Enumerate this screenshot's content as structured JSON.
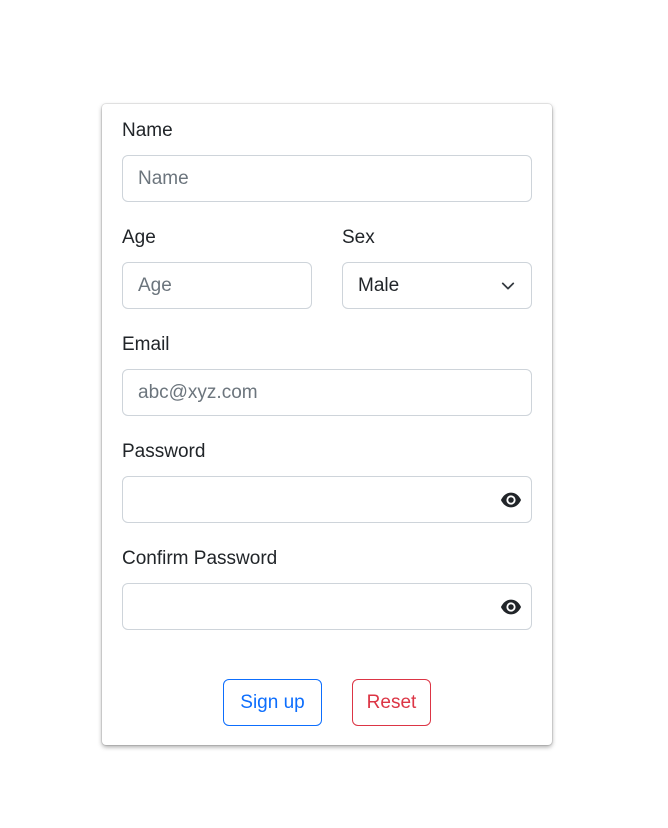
{
  "form": {
    "name": {
      "label": "Name",
      "placeholder": "Name"
    },
    "age": {
      "label": "Age",
      "placeholder": "Age"
    },
    "sex": {
      "label": "Sex",
      "value": "Male"
    },
    "email": {
      "label": "Email",
      "placeholder": "abc@xyz.com"
    },
    "password": {
      "label": "Password",
      "value": ""
    },
    "confirm_password": {
      "label": "Confirm Password",
      "value": ""
    }
  },
  "buttons": {
    "signup": "Sign up",
    "reset": "Reset"
  },
  "colors": {
    "primary": "#0d6efd",
    "danger": "#dc3545",
    "border": "#ced4da"
  },
  "icons": {
    "sex_select": "chevron-down-icon",
    "password_toggle": "eye-icon",
    "confirm_toggle": "eye-icon"
  }
}
